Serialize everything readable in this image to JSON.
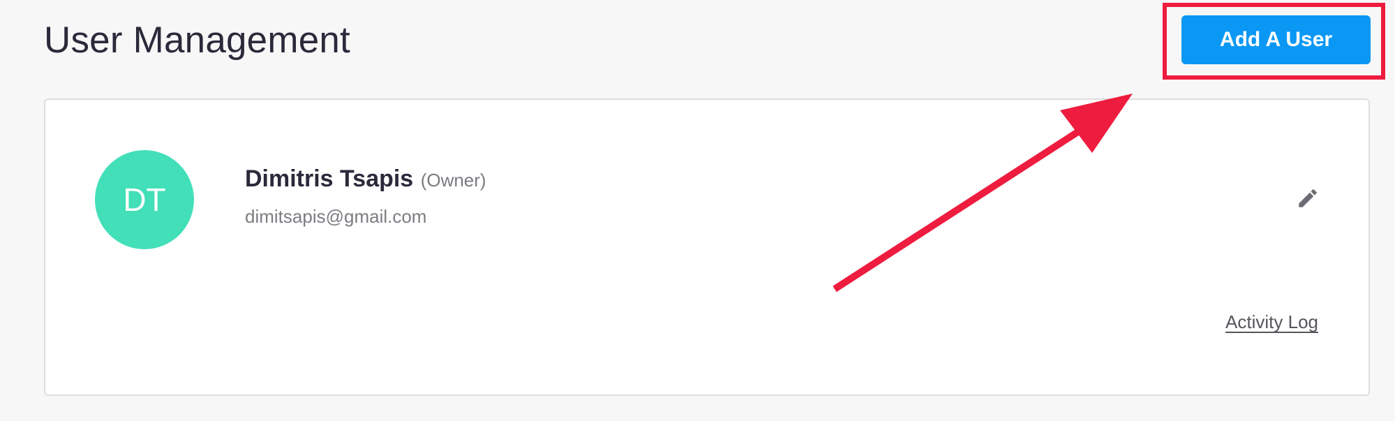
{
  "page": {
    "title": "User Management"
  },
  "header": {
    "add_user_label": "Add A User"
  },
  "user_card": {
    "avatar_initials": "DT",
    "name": "Dimitris Tsapis",
    "role": "(Owner)",
    "email": "dimitsapis@gmail.com",
    "edit_icon": "pencil-icon",
    "activity_log_label": "Activity Log"
  },
  "colors": {
    "accent": "#0b98f5",
    "avatar": "#42dfb8",
    "annotation": "#ee1c3e",
    "background": "#f7f7f7"
  }
}
